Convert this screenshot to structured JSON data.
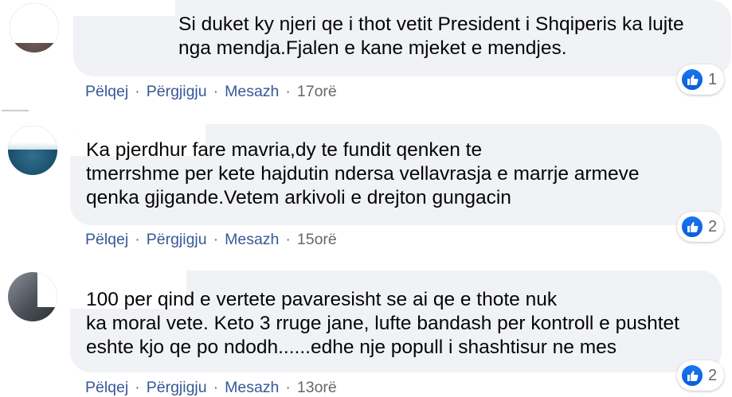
{
  "comments": [
    {
      "text": "Si duket ky njeri qe i thot vetit President i Shqiperis ka lujte\nnga mendja.Fjalen e kane mjeket e mendjes.",
      "reaction_count": "1",
      "actions": {
        "like": "Pëlqej",
        "reply": "Përgjigju",
        "message": "Mesazh",
        "time": "17orë"
      }
    },
    {
      "text": "Ka pjerdhur fare mavria,dy te fundit qenken te\ntmerrshme per kete hajdutin ndersa vellavrasja e marrje armeve\nqenka gjigande.Vetem arkivoli e drejton gungacin",
      "reaction_count": "2",
      "actions": {
        "like": "Pëlqej",
        "reply": "Përgjigju",
        "message": "Mesazh",
        "time": "15orë"
      }
    },
    {
      "text": "100 per qind e vertete pavaresisht se ai qe e thote nuk\nka moral vete. Keto 3 rruge jane, lufte bandash per kontroll e pushtet\neshte kjo qe po ndodh......edhe nje popull i shashtisur ne mes",
      "reaction_count": "2",
      "actions": {
        "like": "Pëlqej",
        "reply": "Përgjigju",
        "message": "Mesazh",
        "time": "13orë"
      }
    }
  ],
  "separator": "·",
  "colors": {
    "bubble": "#f0f2f5",
    "link": "#385898",
    "meta": "#65676b",
    "like_blue": "#1877f2"
  },
  "icons": {
    "reaction": "like-thumb-icon"
  }
}
